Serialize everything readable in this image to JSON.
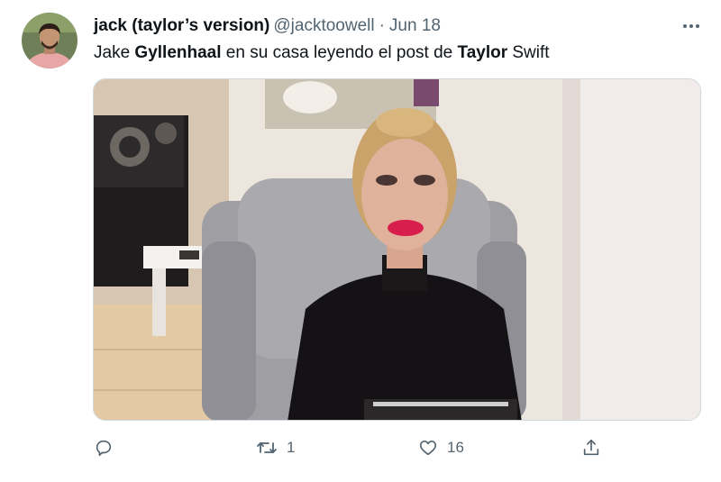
{
  "tweet": {
    "display_name": "jack (taylor’s version)",
    "handle": "@jacktoowell",
    "separator": "·",
    "date": "Jun 18",
    "text_parts": [
      "Jake ",
      "Gyllenhaal",
      " en su casa leyendo el post de ",
      "Taylor",
      " Swift"
    ],
    "media": {
      "description": "photo"
    },
    "actions": {
      "reply_count": "",
      "retweet_count": "1",
      "like_count": "16"
    },
    "icons": {
      "reply": "reply-icon",
      "retweet": "retweet-icon",
      "like": "heart-icon",
      "share": "share-icon",
      "more": "more-icon"
    }
  },
  "colors": {
    "text_primary": "#0f1419",
    "text_secondary": "#536471",
    "border": "#cfd9de"
  }
}
